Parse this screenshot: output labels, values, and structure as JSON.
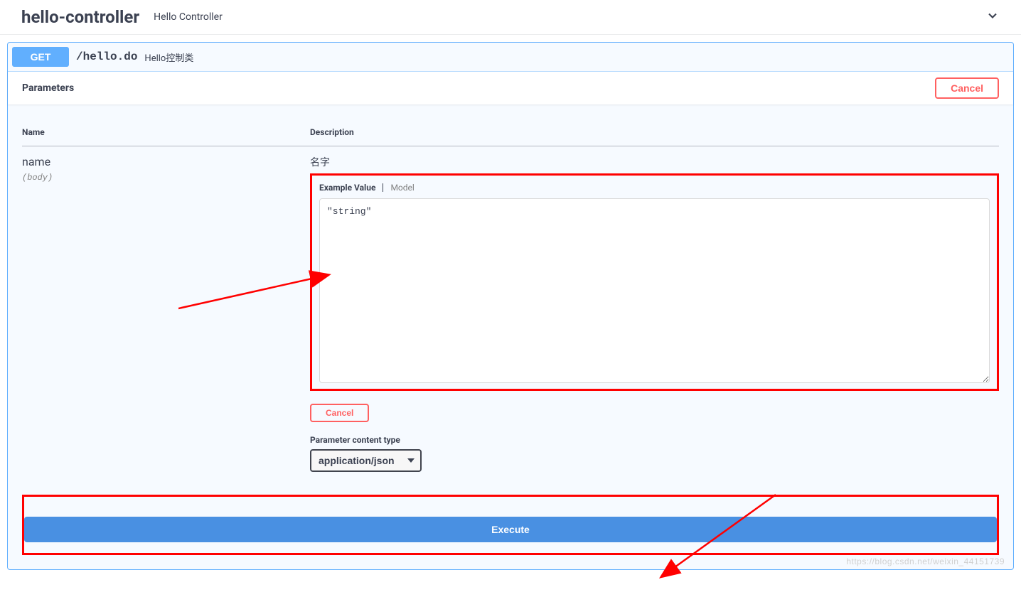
{
  "tag": {
    "name": "hello-controller",
    "description": "Hello Controller"
  },
  "operation": {
    "method": "GET",
    "path": "/hello.do",
    "summary": "Hello控制类"
  },
  "parameters_section": {
    "title": "Parameters",
    "cancel_label": "Cancel",
    "columns": {
      "name": "Name",
      "description": "Description"
    },
    "rows": [
      {
        "name": "name",
        "in": "(body)",
        "description": "名字",
        "tabs": {
          "example": "Example Value",
          "model": "Model"
        },
        "body_value": "\"string\"",
        "cancel_label": "Cancel",
        "content_type_label": "Parameter content type",
        "content_type_value": "application/json"
      }
    ]
  },
  "execute": {
    "label": "Execute"
  },
  "watermark": "https://blog.csdn.net/weixin_44151739"
}
